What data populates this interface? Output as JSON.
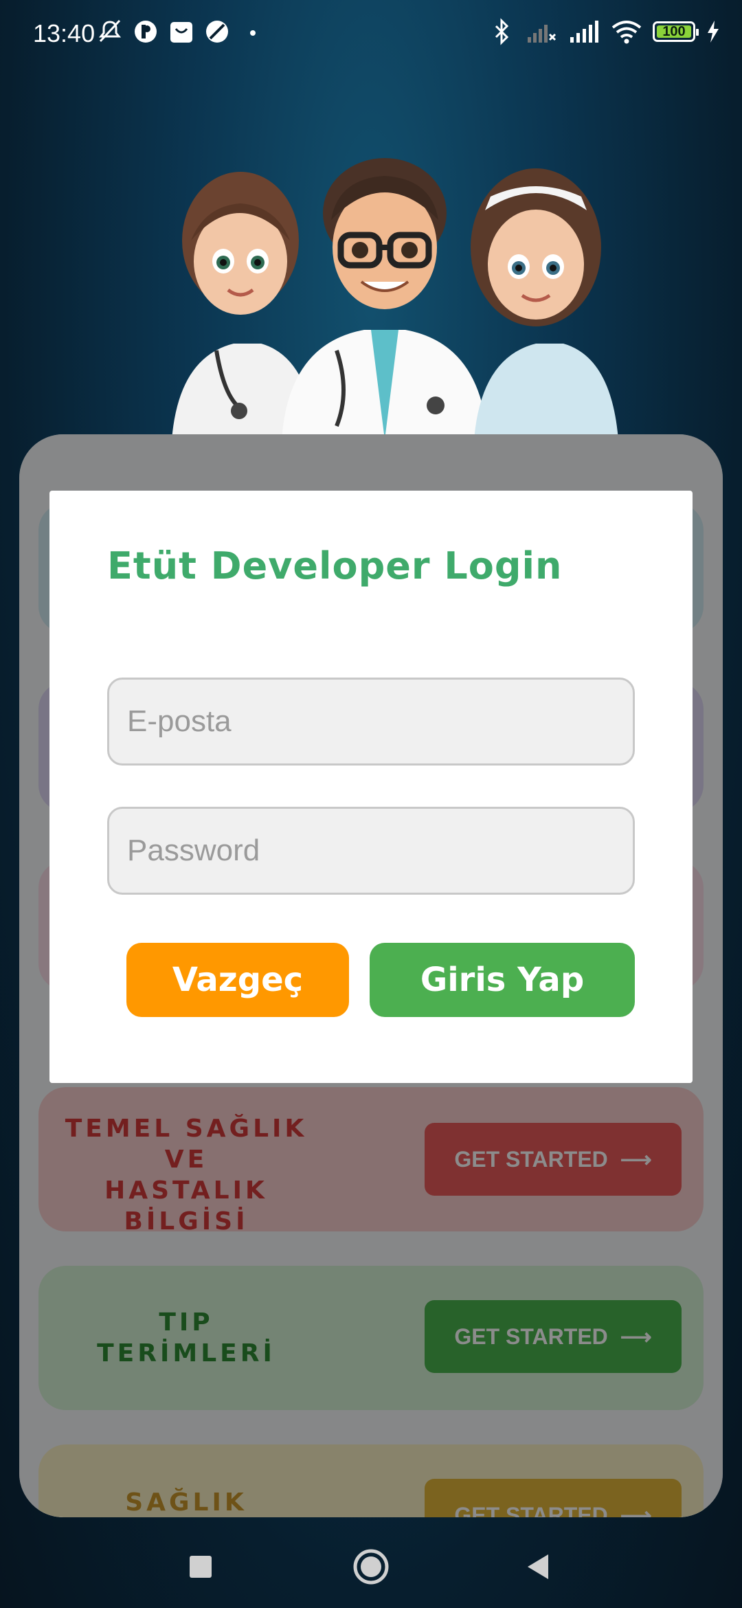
{
  "status_bar": {
    "time": "13:40",
    "left_icons": [
      "mute-bell-icon",
      "app-icon-p",
      "store-icon",
      "no-entry-icon",
      "dot-icon"
    ],
    "right_icons": [
      "bluetooth-icon",
      "signal-off-icon",
      "signal-icon",
      "wifi-icon",
      "battery-icon",
      "charging-icon"
    ],
    "battery_level": "100"
  },
  "hero": {
    "image": "three-doctors-illustration"
  },
  "background_list": {
    "rows": [
      {
        "title_lines": [
          "TEMEL SAĞLIK",
          "VE",
          "HASTALIK BİLGİSİ"
        ],
        "button": "GET STARTED",
        "color": "#e85a5a"
      },
      {
        "title_lines": [
          "TIP",
          "TERİMLERİ"
        ],
        "button": "GET STARTED",
        "color": "#49b24d"
      },
      {
        "title_lines": [
          "SAĞLIK"
        ],
        "button": "GET STARTED",
        "color": "#e0b43a"
      }
    ]
  },
  "modal": {
    "title": "Etüt Developer Login",
    "email_placeholder": "E-posta",
    "password_placeholder": "Password",
    "cancel_label": "Vazgeç",
    "login_label": "Giris Yap"
  },
  "nav_bar": {
    "buttons": [
      "recents-icon",
      "home-icon",
      "back-icon"
    ]
  },
  "colors": {
    "accent_green": "#3faa6b",
    "cancel_orange": "#ff9800",
    "login_green": "#4caf50"
  }
}
